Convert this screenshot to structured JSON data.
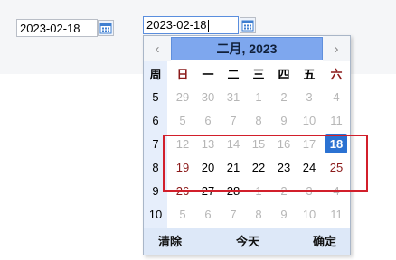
{
  "fields": {
    "first": {
      "value": "2023-02-18"
    },
    "second": {
      "value": "2023-02-18"
    }
  },
  "picker": {
    "title": "二月, 2023",
    "prev_icon": "‹",
    "next_icon": "›",
    "week_header": "周",
    "weekday_headers": [
      "日",
      "一",
      "二",
      "三",
      "四",
      "五",
      "六"
    ],
    "weeks": [
      {
        "week": "5",
        "days": [
          {
            "d": "29",
            "t": "other"
          },
          {
            "d": "30",
            "t": "other"
          },
          {
            "d": "31",
            "t": "other"
          },
          {
            "d": "1",
            "t": "other"
          },
          {
            "d": "2",
            "t": "other"
          },
          {
            "d": "3",
            "t": "other"
          },
          {
            "d": "4",
            "t": "other"
          }
        ]
      },
      {
        "week": "6",
        "days": [
          {
            "d": "5",
            "t": "other"
          },
          {
            "d": "6",
            "t": "other"
          },
          {
            "d": "7",
            "t": "other"
          },
          {
            "d": "8",
            "t": "other"
          },
          {
            "d": "9",
            "t": "other"
          },
          {
            "d": "10",
            "t": "other"
          },
          {
            "d": "11",
            "t": "other"
          }
        ]
      },
      {
        "week": "7",
        "days": [
          {
            "d": "12",
            "t": "other"
          },
          {
            "d": "13",
            "t": "other"
          },
          {
            "d": "14",
            "t": "other"
          },
          {
            "d": "15",
            "t": "other"
          },
          {
            "d": "16",
            "t": "other"
          },
          {
            "d": "17",
            "t": "other"
          },
          {
            "d": "18",
            "t": "selected"
          }
        ]
      },
      {
        "week": "8",
        "days": [
          {
            "d": "19",
            "t": "cur-weekend"
          },
          {
            "d": "20",
            "t": "cur"
          },
          {
            "d": "21",
            "t": "cur"
          },
          {
            "d": "22",
            "t": "cur"
          },
          {
            "d": "23",
            "t": "cur"
          },
          {
            "d": "24",
            "t": "cur"
          },
          {
            "d": "25",
            "t": "cur-weekend"
          }
        ]
      },
      {
        "week": "9",
        "days": [
          {
            "d": "26",
            "t": "cur-weekend"
          },
          {
            "d": "27",
            "t": "cur"
          },
          {
            "d": "28",
            "t": "cur"
          },
          {
            "d": "1",
            "t": "other"
          },
          {
            "d": "2",
            "t": "other"
          },
          {
            "d": "3",
            "t": "other"
          },
          {
            "d": "4",
            "t": "other"
          }
        ]
      },
      {
        "week": "10",
        "days": [
          {
            "d": "5",
            "t": "other"
          },
          {
            "d": "6",
            "t": "other"
          },
          {
            "d": "7",
            "t": "other"
          },
          {
            "d": "8",
            "t": "other"
          },
          {
            "d": "9",
            "t": "other"
          },
          {
            "d": "10",
            "t": "other"
          },
          {
            "d": "11",
            "t": "other"
          }
        ]
      }
    ],
    "footer": {
      "clear": "清除",
      "today": "今天",
      "ok": "确定"
    }
  },
  "colors": {
    "accent": "#2b72d2",
    "weekend": "#8b1a1a",
    "highlight": "#d21f2b",
    "title_bg": "#7ea7ee"
  },
  "icons": [
    "calendar-icon",
    "chevron-left-icon",
    "chevron-right-icon"
  ]
}
